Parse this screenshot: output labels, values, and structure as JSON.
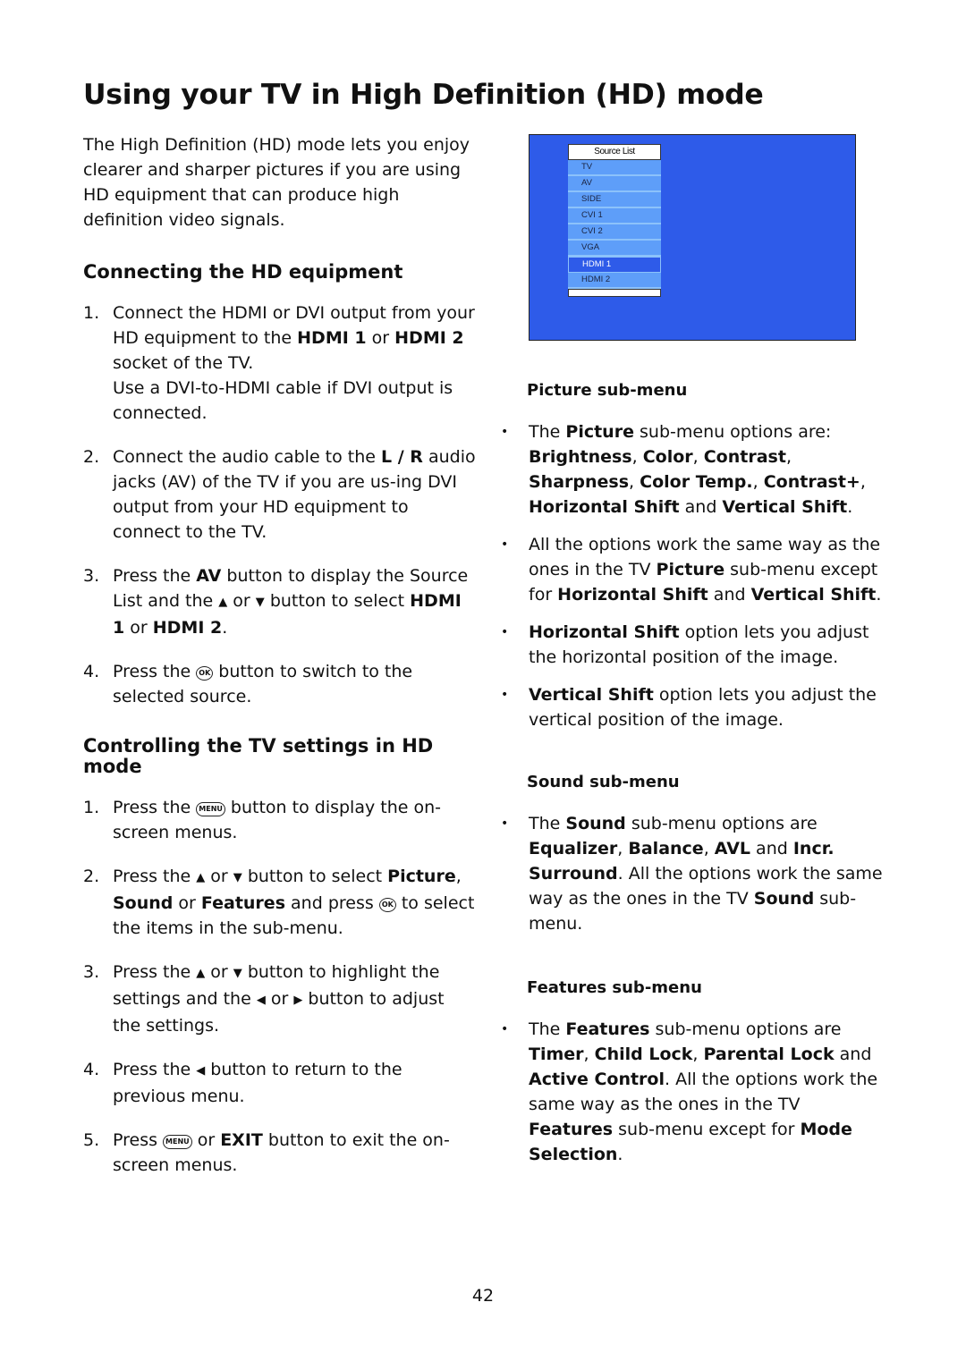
{
  "page": {
    "title": "Using your TV in High Definition (HD) mode",
    "intro": "The High Definition (HD) mode lets you enjoy clearer and sharper pictures if you are using HD equipment that can produce high definition video signals.",
    "page_number": "42"
  },
  "icons": {
    "ok": "OK",
    "menu": "MENU",
    "up": "▲",
    "down": "▼",
    "left": "◀",
    "right": "▶",
    "bullet": "•"
  },
  "connecting": {
    "heading": "Connecting the HD equipment",
    "steps": [
      {
        "num": "1.",
        "t1": "Connect the HDMI or DVI output from your HD equipment to the ",
        "b1": "HDMI 1",
        "t2": " or ",
        "b2": "HDMI 2",
        "t3": " socket of the TV.",
        "note": "Use a DVI-to-HDMI cable if DVI output is connected."
      },
      {
        "num": "2.",
        "t1": "Connect the audio cable to the ",
        "b1": "L / R",
        "t2": " audio jacks (AV) of the TV if you are us-ing DVI output from your HD equipment to connect to the TV."
      },
      {
        "num": "3.",
        "t1": "Press the ",
        "b1": "AV",
        "t2": " button to display the Source List and the ",
        "t3": " or ",
        "t4": " button to select ",
        "b2": "HDMI 1",
        "t5": " or ",
        "b3": "HDMI 2",
        "t6": "."
      },
      {
        "num": "4.",
        "t1": "Press the ",
        "t2": " button to switch to the selected source."
      }
    ]
  },
  "controlling": {
    "heading": "Controlling the TV settings in HD mode",
    "steps": [
      {
        "num": "1.",
        "t1": "Press the ",
        "t2": " button to display the on-screen menus."
      },
      {
        "num": "2.",
        "t1": "Press the ",
        "t2": " or ",
        "t3": " button to select ",
        "b1": "Picture",
        "t4": ", ",
        "b2": "Sound",
        "t5": " or ",
        "b3": "Features",
        "t6": " and press ",
        "t7": " to select the items in the sub-menu."
      },
      {
        "num": "3.",
        "t1": "Press the ",
        "t2": " or ",
        "t3": " button to highlight the settings and the ",
        "t4": " or ",
        "t5": " button to adjust the settings."
      },
      {
        "num": "4.",
        "t1": "Press the ",
        "t2": " button to return to the previous menu."
      },
      {
        "num": "5.",
        "t1": "Press ",
        "t2": " or ",
        "b1": "EXIT",
        "t3": " button to exit the on-screen menus."
      }
    ]
  },
  "tv_screen": {
    "header": "Source List",
    "items": [
      "TV",
      "AV",
      "SIDE",
      "CVI 1",
      "CVI 2",
      "VGA",
      "HDMI 1",
      "HDMI 2"
    ],
    "selected": "HDMI 1",
    "colors": {
      "background": "#2e5be9",
      "item": "#5e9ef9",
      "selected": "#2e5be9"
    }
  },
  "picture": {
    "heading": "Picture sub-menu",
    "b1": {
      "t1": "The ",
      "b1": "Picture",
      "t2": " sub-menu options are: ",
      "b2": "Brightness",
      "t3": ", ",
      "b3": "Color",
      "t4": ", ",
      "b4": "Contrast",
      "t5": ", ",
      "b5": "Sharpness",
      "t6": ", ",
      "b6": "Color Temp.",
      "t7": ", ",
      "b7": "Contrast+",
      "t8": ", ",
      "b8": "Horizontal Shift",
      "t9": " and ",
      "b9": "Vertical Shift",
      "t10": "."
    },
    "b2": {
      "t1": "All the options work the same way as the ones in the TV ",
      "b1": "Picture",
      "t2": " sub-menu except for ",
      "b2": "Horizontal Shift",
      "t3": " and ",
      "b3": "Vertical Shift",
      "t4": "."
    },
    "b3": {
      "b1": "Horizontal Shift",
      "t1": " option lets you adjust the horizontal position of the image."
    },
    "b4": {
      "b1": "Vertical Shift",
      "t1": " option lets you adjust the vertical position of the image."
    }
  },
  "sound": {
    "heading": "Sound sub-menu",
    "b1": {
      "t1": "The ",
      "b1": "Sound",
      "t2": " sub-menu options are ",
      "b2": "Equalizer",
      "t3": ", ",
      "b3": "Balance",
      "t4": ", ",
      "b4": "AVL",
      "t5": " and ",
      "b5": "Incr. Surround",
      "t6": ". All the options work the same way as the ones in the TV ",
      "b6": "Sound",
      "t7": " sub-menu."
    }
  },
  "features": {
    "heading": "Features sub-menu",
    "b1": {
      "t1": "The ",
      "b1": "Features",
      "t2": " sub-menu options are ",
      "b2": "Timer",
      "t3": ", ",
      "b3": "Child Lock",
      "t4": ", ",
      "b4": "Parental Lock",
      "t5": " and ",
      "b5": "Active Control",
      "t6": ". All the options work the same way as the ones in the TV ",
      "b6": "Features",
      "t7": " sub-menu except for ",
      "b7": "Mode Selection",
      "t8": "."
    }
  }
}
